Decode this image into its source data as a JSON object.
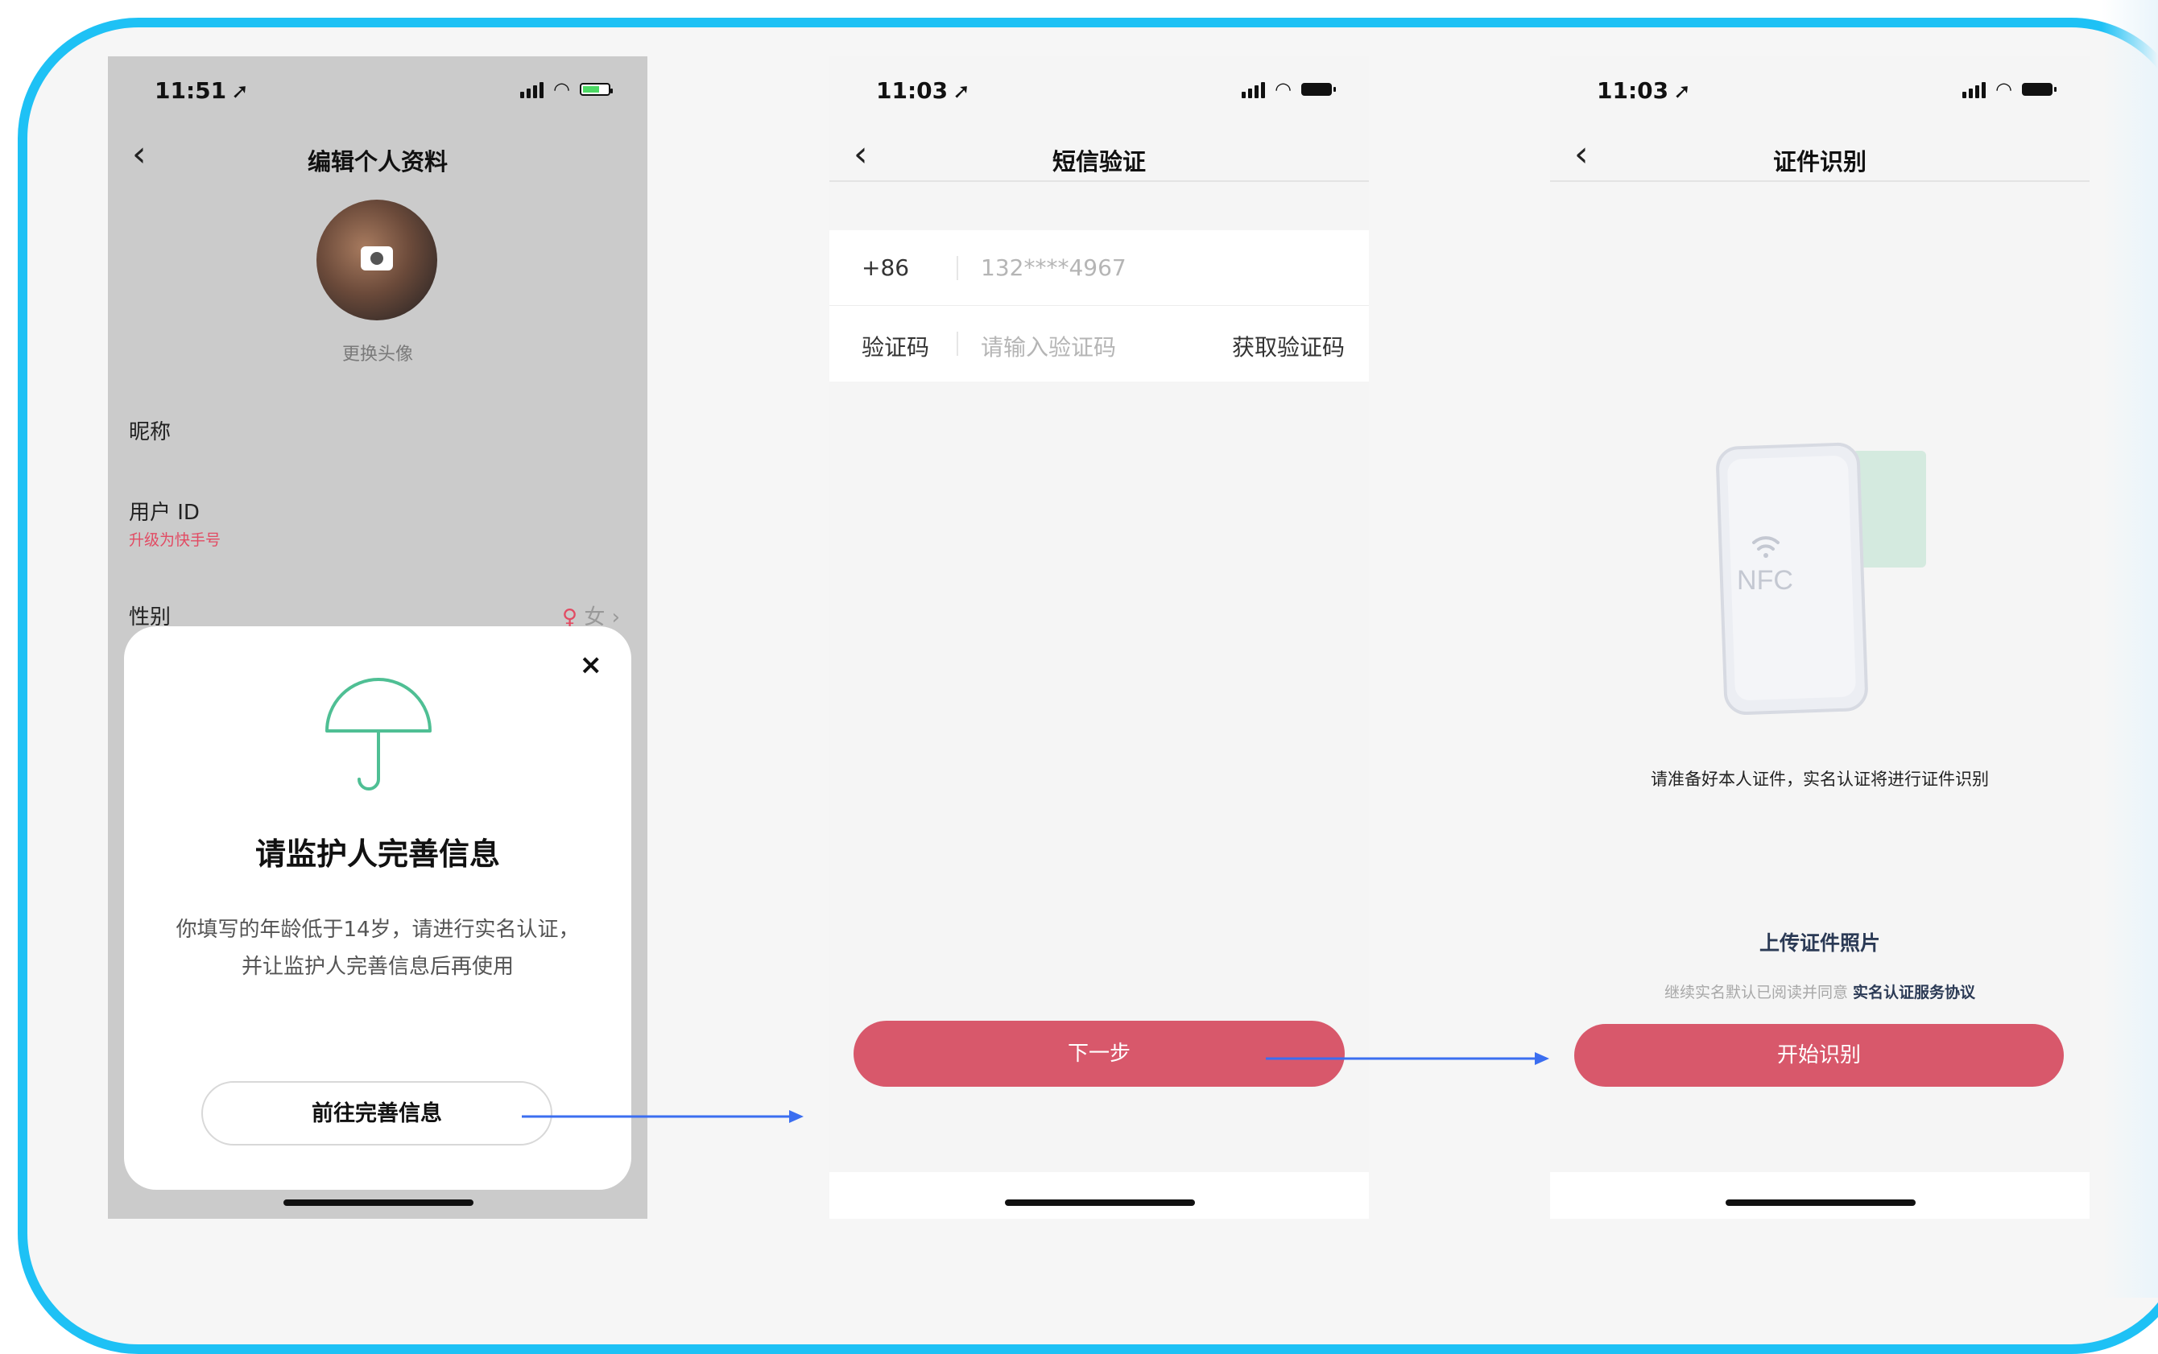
{
  "colors": {
    "frame": "#1ec1f5",
    "accent": "#d8586b",
    "arrow": "#3b6ef0",
    "umbrella": "#4fbf94",
    "link": "#e24b63"
  },
  "phone1": {
    "status_time": "11:51",
    "nav": {
      "back_icon": "chevron-left-icon",
      "title": "编辑个人资料"
    },
    "avatar_label": "更换头像",
    "rows": {
      "nickname": "昵称",
      "user_id": "用户 ID",
      "user_id_sub": "升级为快手号",
      "gender": "性别",
      "gender_value": "女",
      "gender_symbol": "♀"
    },
    "modal": {
      "close": "×",
      "title": "请监护人完善信息",
      "desc_line1": "你填写的年龄低于14岁，请进行实名认证，",
      "desc_line2": "并让监护人完善信息后再使用",
      "button": "前往完善信息"
    }
  },
  "phone2": {
    "status_time": "11:03",
    "nav": {
      "back_icon": "chevron-left-icon",
      "title": "短信验证"
    },
    "form": {
      "country_code": "+86",
      "phone_value": "132****4967",
      "code_label": "验证码",
      "code_placeholder": "请输入验证码",
      "get_code": "获取验证码"
    },
    "next_button": "下一步"
  },
  "phone3": {
    "status_time": "11:03",
    "nav": {
      "back_icon": "chevron-left-icon",
      "title": "证件识别"
    },
    "nfc_text": "NFC",
    "caption": "请准备好本人证件，实名认证将进行证件识别",
    "upload": "上传证件照片",
    "agree_prefix": "继续实名默认已阅读并同意",
    "agree_link": "实名认证服务协议",
    "start_button": "开始识别"
  }
}
